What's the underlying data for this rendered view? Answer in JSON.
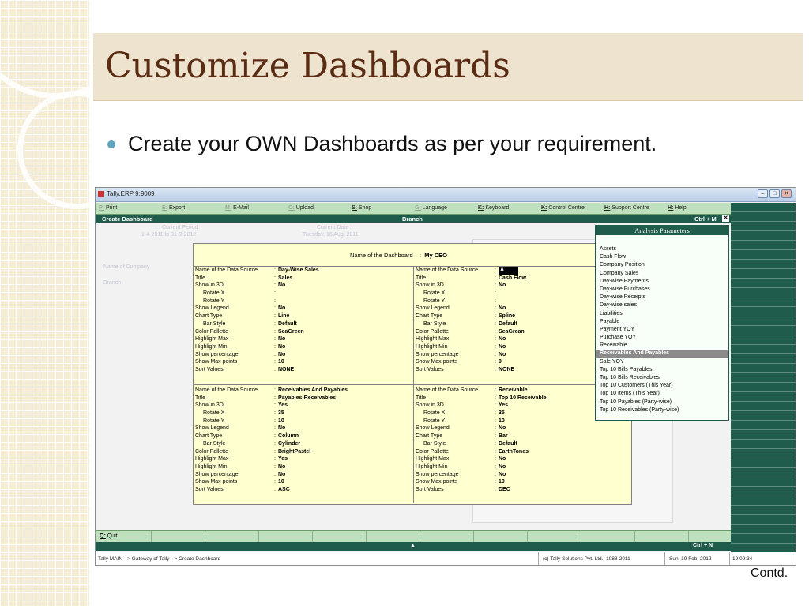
{
  "slide": {
    "title": "Customize Dashboards",
    "bullet": "Create your OWN Dashboards as per your requirement.",
    "contd": "Contd."
  },
  "window": {
    "title": "Tally.ERP 9:9009",
    "buttons": [
      {
        "key": "P:",
        "label": "Print",
        "enabled": false
      },
      {
        "key": "E:",
        "label": "Export",
        "enabled": false
      },
      {
        "key": "M:",
        "label": "E-Mail",
        "enabled": false
      },
      {
        "key": "O:",
        "label": "Upload",
        "enabled": false
      },
      {
        "key": "S:",
        "label": "Shop",
        "enabled": true
      },
      {
        "key": "G:",
        "label": "Language",
        "enabled": false
      },
      {
        "key": "K:",
        "label": "Keyboard",
        "enabled": true
      },
      {
        "key": "K:",
        "label": "Control Centre",
        "enabled": true
      },
      {
        "key": "H:",
        "label": "Support Centre",
        "enabled": true
      },
      {
        "key": "H:",
        "label": "Help",
        "enabled": true
      }
    ],
    "header_left": "Create Dashboard",
    "header_center": "Branch",
    "header_right": "Ctrl + M",
    "close_glyph": "✕"
  },
  "background_fields": {
    "current_period_label": "Current Period",
    "current_period_value": "1-4-2011 to 31-3-2012",
    "current_date_label": "Current Date",
    "current_date_value": "Tuesday, 16 Aug, 2011",
    "company_label": "Name of Company",
    "branch_label": "Branch"
  },
  "dashboard": {
    "name_label": "Name of the Dashboard",
    "name_value": "My CEO",
    "panels": [
      {
        "rows": [
          {
            "label": "Name of the Data Source",
            "value": "Day-Wise Sales",
            "indent": false
          },
          {
            "label": "Title",
            "value": "Sales",
            "indent": false
          },
          {
            "label": "Show in 3D",
            "value": "No",
            "indent": false
          },
          {
            "label": "Rotate X",
            "value": "",
            "indent": true
          },
          {
            "label": "Rotate Y",
            "value": "",
            "indent": true
          },
          {
            "label": "Show Legend",
            "value": "No",
            "indent": false
          },
          {
            "label": "Chart Type",
            "value": "Line",
            "indent": false
          },
          {
            "label": "Bar Style",
            "value": "Default",
            "indent": true
          },
          {
            "label": "Color Pallette",
            "value": "SeaGreen",
            "indent": false
          },
          {
            "label": "Highlight Max",
            "value": "No",
            "indent": false
          },
          {
            "label": "Highlight Min",
            "value": "No",
            "indent": false
          },
          {
            "label": "Show percentage",
            "value": "No",
            "indent": false
          },
          {
            "label": "Show Max points",
            "value": "10",
            "indent": false
          },
          {
            "label": "Sort Values",
            "value": "NONE",
            "indent": false
          }
        ]
      },
      {
        "rows": [
          {
            "label": "Name of the Data Source",
            "value": "A",
            "indent": false,
            "highlight": true
          },
          {
            "label": "Title",
            "value": "Cash Flow",
            "indent": false
          },
          {
            "label": "Show in 3D",
            "value": "No",
            "indent": false
          },
          {
            "label": "Rotate X",
            "value": "",
            "indent": true
          },
          {
            "label": "Rotate Y",
            "value": "",
            "indent": true
          },
          {
            "label": "Show Legend",
            "value": "No",
            "indent": false
          },
          {
            "label": "Chart Type",
            "value": "Spline",
            "indent": false
          },
          {
            "label": "Bar Style",
            "value": "Default",
            "indent": true
          },
          {
            "label": "Color Pallette",
            "value": "SeaGrean",
            "indent": false
          },
          {
            "label": "Highlight Max",
            "value": "No",
            "indent": false
          },
          {
            "label": "Highlight Min",
            "value": "No",
            "indent": false
          },
          {
            "label": "Show percentage",
            "value": "No",
            "indent": false
          },
          {
            "label": "Show Max points",
            "value": "0",
            "indent": false
          },
          {
            "label": "Sort Values",
            "value": "NONE",
            "indent": false
          }
        ]
      },
      {
        "rows": [
          {
            "label": "Name of the Data Source",
            "value": "Receivables And Payables",
            "indent": false
          },
          {
            "label": "Title",
            "value": "Payables-Receivables",
            "indent": false
          },
          {
            "label": "Show in 3D",
            "value": "Yes",
            "indent": false
          },
          {
            "label": "Rotate X",
            "value": "35",
            "indent": true
          },
          {
            "label": "Rotate Y",
            "value": "10",
            "indent": true
          },
          {
            "label": "Show Legend",
            "value": "No",
            "indent": false
          },
          {
            "label": "Chart Type",
            "value": "Column",
            "indent": false
          },
          {
            "label": "Bar Style",
            "value": "Cylinder",
            "indent": true
          },
          {
            "label": "Color Pallette",
            "value": "BrightPastel",
            "indent": false
          },
          {
            "label": "Highlight Max",
            "value": "Yes",
            "indent": false
          },
          {
            "label": "Highlight Min",
            "value": "No",
            "indent": false
          },
          {
            "label": "Show percentage",
            "value": "No",
            "indent": false
          },
          {
            "label": "Show Max points",
            "value": "10",
            "indent": false
          },
          {
            "label": "Sort Values",
            "value": "ASC",
            "indent": false
          }
        ]
      },
      {
        "rows": [
          {
            "label": "Name of the Data Source",
            "value": "Receivable",
            "indent": false
          },
          {
            "label": "Title",
            "value": "Top 10 Receivable",
            "indent": false
          },
          {
            "label": "Show in 3D",
            "value": "Yes",
            "indent": false
          },
          {
            "label": "Rotate X",
            "value": "35",
            "indent": true
          },
          {
            "label": "Rotate Y",
            "value": "10",
            "indent": true
          },
          {
            "label": "Show Legend",
            "value": "No",
            "indent": false
          },
          {
            "label": "Chart Type",
            "value": "Bar",
            "indent": false
          },
          {
            "label": "Bar Style",
            "value": "Default",
            "indent": true
          },
          {
            "label": "Color Pallette",
            "value": "EarthTones",
            "indent": false
          },
          {
            "label": "Highlight Max",
            "value": "No",
            "indent": false
          },
          {
            "label": "Highlight Min",
            "value": "No",
            "indent": false
          },
          {
            "label": "Show percentage",
            "value": "No",
            "indent": false
          },
          {
            "label": "Show Max points",
            "value": "10",
            "indent": false
          },
          {
            "label": "Sort Values",
            "value": "DEC",
            "indent": false
          }
        ]
      }
    ]
  },
  "analysis": {
    "title": "Analysis Parameters",
    "items": [
      "Assets",
      "Cash Flow",
      "Company Position",
      "Company Sales",
      "Day-wise Payments",
      "Day-wise Purchases",
      "Day-wise Receipts",
      "Day-wise sales",
      "Liabilities",
      "Payable",
      "Payment YOY",
      "Purchase YOY",
      "Receivable",
      "Receivables And Payables",
      "Sale YOY",
      "Top 10 Bills Payables",
      "Top 10 Bills Receivables",
      "Top 10 Customers (This Year)",
      "Top 10 Items (This Year)",
      "Top 10 Payables (Party-wise)",
      "Top 10 Receivables (Party-wise)"
    ],
    "selected": "Receivables And Payables"
  },
  "footer": {
    "quit_key": "Q:",
    "quit_label": "Quit",
    "up_glyph": "▲",
    "ctrl_n": "Ctrl + N",
    "path": "Tally MAIN --> Gateway of Tally --> Create Dashboard",
    "copyright": "(c) Tally Solutions Pvt. Ltd., 1988-2011",
    "date": "Sun, 19 Feb, 2012",
    "time": "19:09:34"
  },
  "colors": {
    "tally_green": "#1f5c4b",
    "button_green": "#bfe0bd",
    "form_yellow": "#ffffd0",
    "title_brown": "#5b2c14",
    "bullet_blue": "#5fa4bd"
  }
}
